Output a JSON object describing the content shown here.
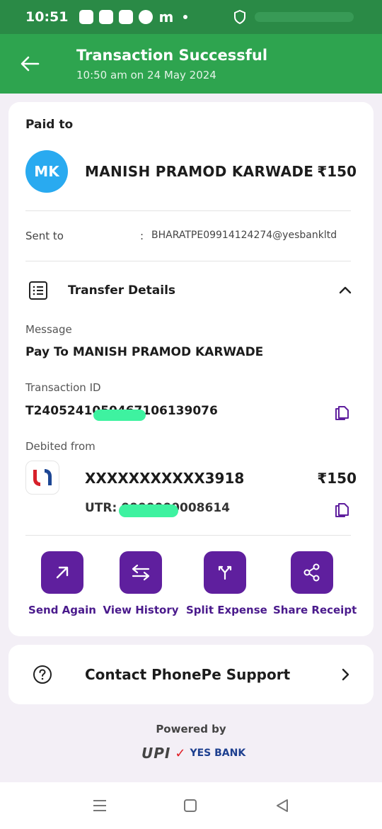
{
  "status_bar": {
    "time": "10:51",
    "notif_m": "m"
  },
  "header": {
    "title": "Transaction Successful",
    "subtitle": "10:50 am on 24 May 2024"
  },
  "payee_card": {
    "paid_to_label": "Paid to",
    "avatar_initials": "MK",
    "payee_name": "MANISH PRAMOD KARWADE",
    "amount": "₹150",
    "sent_to_label": "Sent to",
    "colon": ":",
    "upi_id": "BHARATPE09914124274@yesbankltd"
  },
  "transfer_details": {
    "title": "Transfer Details",
    "message_label": "Message",
    "message_value": "Pay To MANISH PRAMOD KARWADE",
    "transaction_id_label": "Transaction ID",
    "transaction_id_value": "T2405241050467106139076",
    "debited_from_label": "Debited from",
    "account_number": "XXXXXXXXXXX3918",
    "debited_amount": "₹150",
    "utr_value": "UTR: 0000000008614"
  },
  "actions": [
    {
      "label": "Send Again",
      "icon": "arrow-up-right-icon"
    },
    {
      "label": "View History",
      "icon": "swap-arrows-icon"
    },
    {
      "label": "Split Expense",
      "icon": "split-icon"
    },
    {
      "label": "Share Receipt",
      "icon": "share-icon"
    }
  ],
  "support": {
    "label": "Contact PhonePe Support"
  },
  "footer": {
    "powered_by": "Powered by",
    "upi_logo": "UPI",
    "bank_name": "YES BANK"
  },
  "colors": {
    "status_bar": "#2a8a46",
    "header": "#2ea44f",
    "accent_purple": "#5f1f9e",
    "avatar_blue": "#29aaf0",
    "background": "#f3eff6"
  }
}
